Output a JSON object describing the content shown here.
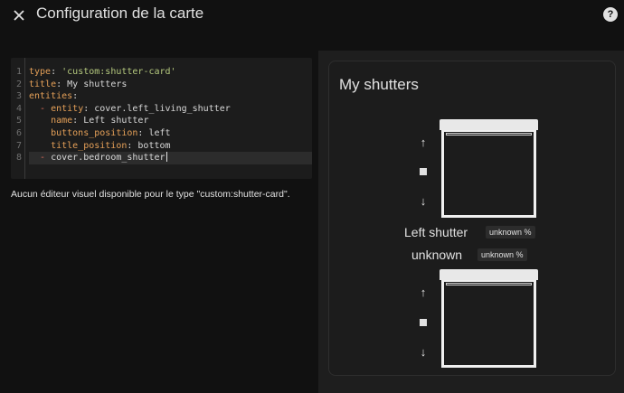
{
  "header": {
    "close_icon": "close-icon",
    "title": "Configuration de la carte",
    "help_icon": "help-icon",
    "help_glyph": "?"
  },
  "editor": {
    "line_numbers": [
      "1",
      "2",
      "3",
      "4",
      "5",
      "6",
      "7",
      "8"
    ],
    "lines": [
      {
        "tokens": [
          {
            "t": "type",
            "c": "k"
          },
          {
            "t": ": ",
            "c": "p"
          },
          {
            "t": "'custom:shutter-card'",
            "c": "s"
          }
        ]
      },
      {
        "tokens": [
          {
            "t": "title",
            "c": "k"
          },
          {
            "t": ": My shutters",
            "c": "p"
          }
        ]
      },
      {
        "tokens": [
          {
            "t": "entities",
            "c": "k"
          },
          {
            "t": ":",
            "c": "p"
          }
        ]
      },
      {
        "tokens": [
          {
            "t": "  - ",
            "c": "cm"
          },
          {
            "t": "entity",
            "c": "k"
          },
          {
            "t": ": cover.left_living_shutter",
            "c": "p"
          }
        ]
      },
      {
        "tokens": [
          {
            "t": "    name",
            "c": "k"
          },
          {
            "t": ": Left shutter",
            "c": "p"
          }
        ]
      },
      {
        "tokens": [
          {
            "t": "    buttons_position",
            "c": "k"
          },
          {
            "t": ": left",
            "c": "p"
          }
        ]
      },
      {
        "tokens": [
          {
            "t": "    title_position",
            "c": "k"
          },
          {
            "t": ": bottom",
            "c": "p"
          }
        ]
      },
      {
        "tokens": [
          {
            "t": "  - ",
            "c": "cm"
          },
          {
            "t": "cover.bedroom_shutter",
            "c": "p"
          }
        ]
      }
    ],
    "active_line": 8
  },
  "no_visual_editor": "Aucun éditeur visuel disponible pour le type \"custom:shutter-card\".",
  "card": {
    "title": "My shutters",
    "shutters": [
      {
        "name": "Left shutter",
        "position": "unknown %",
        "up_icon": "arrow-up-icon",
        "stop_icon": "stop-icon",
        "down_icon": "arrow-down-icon"
      },
      {
        "name": "unknown",
        "position": "unknown %",
        "up_icon": "arrow-up-icon",
        "stop_icon": "stop-icon",
        "down_icon": "arrow-down-icon"
      }
    ],
    "glyphs": {
      "up": "↑",
      "down": "↓"
    }
  }
}
